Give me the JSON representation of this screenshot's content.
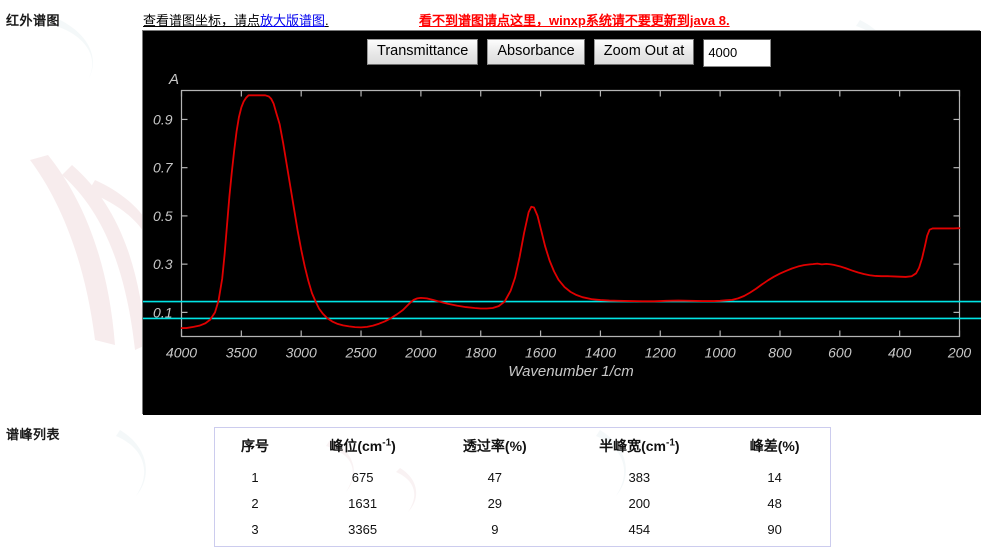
{
  "labels": {
    "spectrum_section": "红外谱图",
    "peaklist_section": "谱峰列表"
  },
  "notes": {
    "coord_prefix": "查看谱图坐标，请点",
    "coord_link": "放大版谱图",
    "coord_suffix": ".",
    "warning": "看不到谱图请点这里，winxp系统请不要更新到java 8."
  },
  "toolbar": {
    "transmittance_label": "Transmittance",
    "absorbance_label": "Absorbance",
    "zoom_out_label": "Zoom Out at",
    "zoom_value": "4000",
    "zoom_placeholder": "4000"
  },
  "colors": {
    "panel_background": "#000000",
    "curve": "#e00000",
    "baseline": "#00e5e5",
    "axis": "#b4b4b4",
    "link": "#0000ee",
    "warning": "#ff0000",
    "table_border": "#ccccee"
  },
  "chart_data": {
    "type": "line",
    "title": "",
    "xlabel": "Wavenumber 1/cm",
    "ylabel": "A",
    "grid": false,
    "legend": null,
    "xtick_labels": [
      "4000",
      "3500",
      "3000",
      "2500",
      "2000",
      "1800",
      "1600",
      "1400",
      "1200",
      "1000",
      "800",
      "600",
      "400",
      "200"
    ],
    "ytick_labels": [
      "0.9",
      "0.7",
      "0.5",
      "0.3",
      "0.1"
    ],
    "ytick_values": [
      0.9,
      0.7,
      0.5,
      0.3,
      0.1
    ],
    "ylim": [
      0.0,
      1.02
    ],
    "x_axis_scale": "piecewise: 4000-2000 compressed, 2000-200 expanded",
    "baselines": [
      0.145,
      0.075
    ],
    "series": [
      {
        "name": "absorbance",
        "color": "#e00000",
        "points": [
          [
            4000,
            0.035
          ],
          [
            3960,
            0.035
          ],
          [
            3900,
            0.04
          ],
          [
            3850,
            0.045
          ],
          [
            3800,
            0.055
          ],
          [
            3760,
            0.07
          ],
          [
            3720,
            0.1
          ],
          [
            3690,
            0.15
          ],
          [
            3660,
            0.24
          ],
          [
            3640,
            0.34
          ],
          [
            3620,
            0.46
          ],
          [
            3600,
            0.58
          ],
          [
            3580,
            0.68
          ],
          [
            3560,
            0.77
          ],
          [
            3540,
            0.85
          ],
          [
            3520,
            0.91
          ],
          [
            3500,
            0.95
          ],
          [
            3480,
            0.975
          ],
          [
            3460,
            0.99
          ],
          [
            3440,
            1.0
          ],
          [
            3400,
            1.0
          ],
          [
            3365,
            1.0
          ],
          [
            3330,
            1.0
          ],
          [
            3300,
            1.0
          ],
          [
            3270,
            0.995
          ],
          [
            3250,
            0.985
          ],
          [
            3230,
            0.965
          ],
          [
            3210,
            0.93
          ],
          [
            3180,
            0.88
          ],
          [
            3150,
            0.8
          ],
          [
            3120,
            0.71
          ],
          [
            3090,
            0.62
          ],
          [
            3060,
            0.53
          ],
          [
            3030,
            0.44
          ],
          [
            3000,
            0.36
          ],
          [
            2970,
            0.29
          ],
          [
            2940,
            0.23
          ],
          [
            2910,
            0.18
          ],
          [
            2880,
            0.145
          ],
          [
            2850,
            0.115
          ],
          [
            2820,
            0.095
          ],
          [
            2780,
            0.075
          ],
          [
            2740,
            0.062
          ],
          [
            2700,
            0.053
          ],
          [
            2650,
            0.046
          ],
          [
            2600,
            0.042
          ],
          [
            2550,
            0.039
          ],
          [
            2500,
            0.038
          ],
          [
            2450,
            0.04
          ],
          [
            2400,
            0.045
          ],
          [
            2350,
            0.053
          ],
          [
            2300,
            0.063
          ],
          [
            2250,
            0.076
          ],
          [
            2200,
            0.092
          ],
          [
            2150,
            0.11
          ],
          [
            2120,
            0.125
          ],
          [
            2090,
            0.14
          ],
          [
            2060,
            0.152
          ],
          [
            2030,
            0.158
          ],
          [
            2000,
            0.16
          ],
          [
            1980,
            0.158
          ],
          [
            1960,
            0.152
          ],
          [
            1940,
            0.145
          ],
          [
            1910,
            0.136
          ],
          [
            1880,
            0.128
          ],
          [
            1850,
            0.122
          ],
          [
            1820,
            0.118
          ],
          [
            1800,
            0.116
          ],
          [
            1780,
            0.116
          ],
          [
            1760,
            0.118
          ],
          [
            1740,
            0.126
          ],
          [
            1720,
            0.145
          ],
          [
            1700,
            0.19
          ],
          [
            1685,
            0.245
          ],
          [
            1670,
            0.33
          ],
          [
            1655,
            0.43
          ],
          [
            1640,
            0.515
          ],
          [
            1631,
            0.538
          ],
          [
            1622,
            0.535
          ],
          [
            1610,
            0.5
          ],
          [
            1598,
            0.44
          ],
          [
            1585,
            0.375
          ],
          [
            1570,
            0.315
          ],
          [
            1555,
            0.27
          ],
          [
            1540,
            0.235
          ],
          [
            1520,
            0.205
          ],
          [
            1500,
            0.185
          ],
          [
            1480,
            0.172
          ],
          [
            1460,
            0.163
          ],
          [
            1430,
            0.155
          ],
          [
            1400,
            0.151
          ],
          [
            1370,
            0.149
          ],
          [
            1340,
            0.148
          ],
          [
            1300,
            0.147
          ],
          [
            1260,
            0.146
          ],
          [
            1220,
            0.146
          ],
          [
            1180,
            0.148
          ],
          [
            1140,
            0.149
          ],
          [
            1100,
            0.148
          ],
          [
            1060,
            0.147
          ],
          [
            1020,
            0.147
          ],
          [
            1000,
            0.148
          ],
          [
            980,
            0.15
          ],
          [
            960,
            0.152
          ],
          [
            940,
            0.158
          ],
          [
            920,
            0.168
          ],
          [
            900,
            0.182
          ],
          [
            880,
            0.198
          ],
          [
            860,
            0.216
          ],
          [
            840,
            0.233
          ],
          [
            820,
            0.248
          ],
          [
            800,
            0.261
          ],
          [
            780,
            0.272
          ],
          [
            760,
            0.282
          ],
          [
            740,
            0.29
          ],
          [
            720,
            0.296
          ],
          [
            700,
            0.299
          ],
          [
            690,
            0.3
          ],
          [
            675,
            0.302
          ],
          [
            660,
            0.299
          ],
          [
            645,
            0.301
          ],
          [
            630,
            0.299
          ],
          [
            620,
            0.297
          ],
          [
            600,
            0.291
          ],
          [
            580,
            0.283
          ],
          [
            560,
            0.274
          ],
          [
            540,
            0.266
          ],
          [
            520,
            0.259
          ],
          [
            500,
            0.254
          ],
          [
            480,
            0.251
          ],
          [
            460,
            0.25
          ],
          [
            440,
            0.25
          ],
          [
            420,
            0.249
          ],
          [
            400,
            0.248
          ],
          [
            380,
            0.247
          ],
          [
            360,
            0.25
          ],
          [
            345,
            0.262
          ],
          [
            335,
            0.285
          ],
          [
            325,
            0.325
          ],
          [
            315,
            0.378
          ],
          [
            308,
            0.418
          ],
          [
            300,
            0.443
          ],
          [
            290,
            0.448
          ],
          [
            270,
            0.448
          ],
          [
            240,
            0.448
          ],
          [
            220,
            0.448
          ],
          [
            200,
            0.449
          ]
        ]
      }
    ]
  },
  "peak_table": {
    "headers": [
      {
        "text": "序号",
        "unit": ""
      },
      {
        "text": "峰位(cm",
        "unit": "-1",
        "tail": ")"
      },
      {
        "text": "透过率(%)",
        "unit": ""
      },
      {
        "text": "半峰宽(cm",
        "unit": "-1",
        "tail": ")"
      },
      {
        "text": "峰差(%)",
        "unit": ""
      }
    ],
    "rows": [
      {
        "index": "1",
        "position": "675",
        "transmittance": "47",
        "fwhm": "383",
        "peak_diff": "14"
      },
      {
        "index": "2",
        "position": "1631",
        "transmittance": "29",
        "fwhm": "200",
        "peak_diff": "48"
      },
      {
        "index": "3",
        "position": "3365",
        "transmittance": "9",
        "fwhm": "454",
        "peak_diff": "90"
      }
    ]
  }
}
